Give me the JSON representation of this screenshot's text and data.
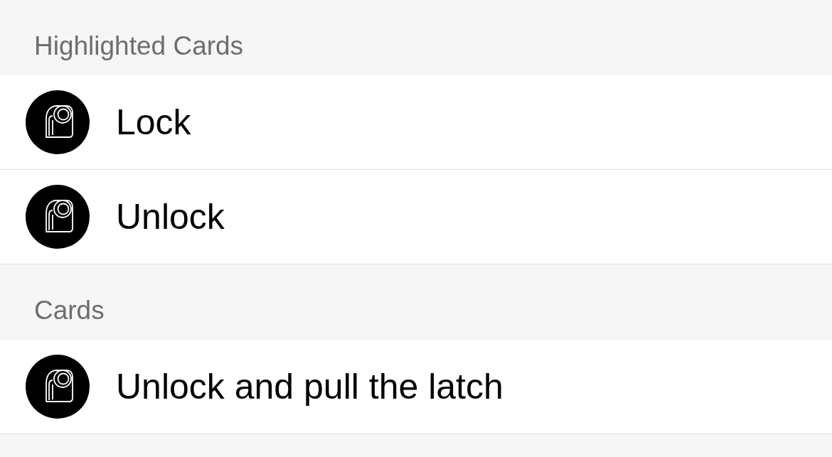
{
  "sections": [
    {
      "title": "Highlighted Cards",
      "items": [
        {
          "label": "Lock"
        },
        {
          "label": "Unlock"
        }
      ]
    },
    {
      "title": "Cards",
      "items": [
        {
          "label": "Unlock and pull the latch"
        }
      ]
    }
  ]
}
